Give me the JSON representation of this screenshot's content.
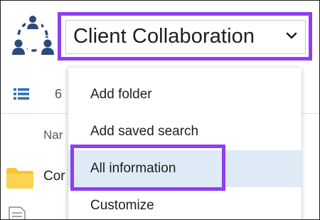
{
  "header": {
    "title": "Client Collaboration"
  },
  "toolbar": {
    "item_count": "6"
  },
  "list": {
    "name_column": "Nar",
    "rows": [
      {
        "type": "folder",
        "name": "Cor"
      },
      {
        "type": "document",
        "name": ""
      }
    ]
  },
  "dropdown": {
    "items": [
      {
        "label": "Add folder",
        "selected": false
      },
      {
        "label": "Add saved search",
        "selected": false
      },
      {
        "label": "All information",
        "selected": true
      },
      {
        "label": "Customize",
        "selected": false
      }
    ]
  },
  "colors": {
    "highlight_outline": "#8e3ff0",
    "selected_row": "#deebf7",
    "icon_navy": "#2c4a7a",
    "folder_yellow": "#f7c531"
  },
  "icons": {
    "workspace": "team-icon",
    "view": "list-view-icon",
    "dropdown": "chevron-down-icon",
    "folder": "folder-icon",
    "document": "document-icon"
  }
}
